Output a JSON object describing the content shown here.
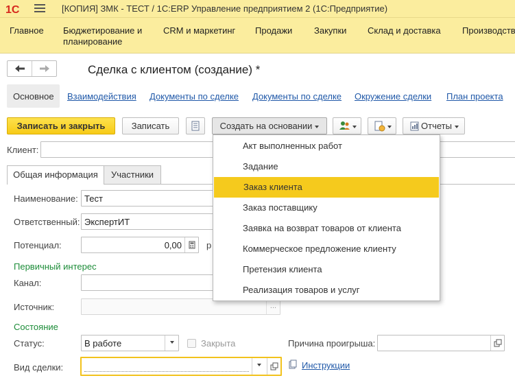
{
  "window": {
    "title": "[КОПИЯ] ЗМК - ТЕСТ / 1С:ERP Управление предприятием 2  (1С:Предприятие)",
    "logo_text": "1С"
  },
  "sections": [
    {
      "label": "Главное"
    },
    {
      "label": "Бюджетирование и\nпланирование"
    },
    {
      "label": "CRM и маркетинг"
    },
    {
      "label": "Продажи"
    },
    {
      "label": "Закупки"
    },
    {
      "label": "Склад и доставка"
    },
    {
      "label": "Производство"
    }
  ],
  "form": {
    "title": "Сделка с клиентом (создание) *",
    "nav": {
      "main": "Основное",
      "links": [
        "Взаимодействия",
        "Документы по сделке",
        "Документы по сделке",
        "Окружение сделки",
        "План проекта"
      ]
    },
    "toolbar": {
      "save_close": "Записать и закрыть",
      "save": "Записать",
      "create_based": "Создать на основании",
      "reports": "Отчеты"
    },
    "client_label": "Клиент:",
    "tabs": {
      "general": "Общая информация",
      "participants": "Участники"
    },
    "fields": {
      "name_label": "Наименование:",
      "name_value": "Тест",
      "responsible_label": "Ответственный:",
      "responsible_value": "ЭкспертИТ",
      "potential_label": "Потенциал:",
      "potential_value": "0,00",
      "currency": "р",
      "primary_interest": "Первичный интерес",
      "channel_label": "Канал:",
      "source_label": "Источник:",
      "state_group": "Состояние",
      "status_label": "Статус:",
      "status_value": "В работе",
      "closed_label": "Закрыта",
      "loss_reason_label": "Причина проигрыша:",
      "deal_type_label": "Вид сделки:",
      "instructions_link": "Инструкции",
      "ellipsis": "..."
    }
  },
  "dropdown": {
    "items": [
      "Акт выполненных работ",
      "Задание",
      "Заказ клиента",
      "Заказ поставщику",
      "Заявка на возврат товаров от клиента",
      "Коммерческое предложение клиенту",
      "Претензия клиента",
      "Реализация товаров и услуг"
    ],
    "highlighted_index": 2
  },
  "colors": {
    "titlebar": "#fbed9e",
    "accent_button": "#f7cb17",
    "highlight": "#f5ca1d",
    "link": "#1f58a8",
    "group_label": "#1c8c38"
  }
}
